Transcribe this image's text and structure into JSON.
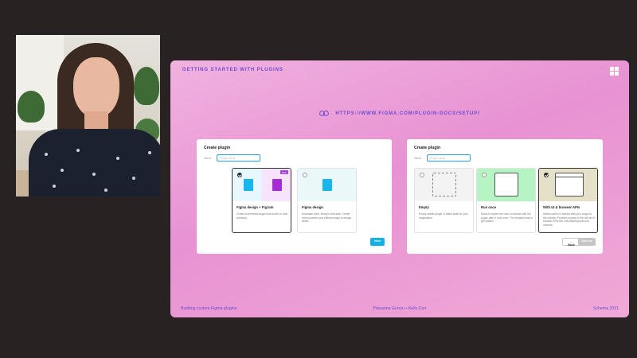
{
  "slide": {
    "title": "GETTING STARTED WITH PLUGINS",
    "url": "HTTPS://WWW.FIGMA.COM/PLUGIN-DOCS/SETUP/",
    "accent_color": "#6d49d1",
    "footer": {
      "left": "Building custom Figma plugins",
      "middle": "Prasanna Gururu  •  Kelly Corr",
      "right": "Schema 2021"
    }
  },
  "left_dialog": {
    "title": "Create plugin",
    "name_label": "Name",
    "name_placeholder": "Plugin name",
    "options": [
      {
        "name": "Figma design + FigJam",
        "badge": "Beta",
        "description": "Create a universal plugin that works on both products.",
        "selected": true
      },
      {
        "name": "Figma design",
        "description": "Automate work. Bring in real data. Create more powerful and efficient ways to design better.",
        "selected": false
      }
    ],
    "next_label": "Next"
  },
  "right_dialog": {
    "title": "Create plugin",
    "name_label": "Name",
    "name_placeholder": "Plugin name",
    "options": [
      {
        "name": "Empty",
        "description": "Empty starter plugin. A blank slate for your imagination.",
        "selected": false
      },
      {
        "name": "Run once",
        "description": "Doesn't require the user to interact with the plugin after it runs once. The simplest way to get started.",
        "selected": false
      },
      {
        "name": "With UI & browser APIs",
        "description": "Allows users to interact with your plugin in the canvas. Provides access to the full set of browser APIs like XMLHttpRequest and network.",
        "selected": true
      }
    ],
    "back_label": "Back",
    "save_label": "Save as"
  }
}
